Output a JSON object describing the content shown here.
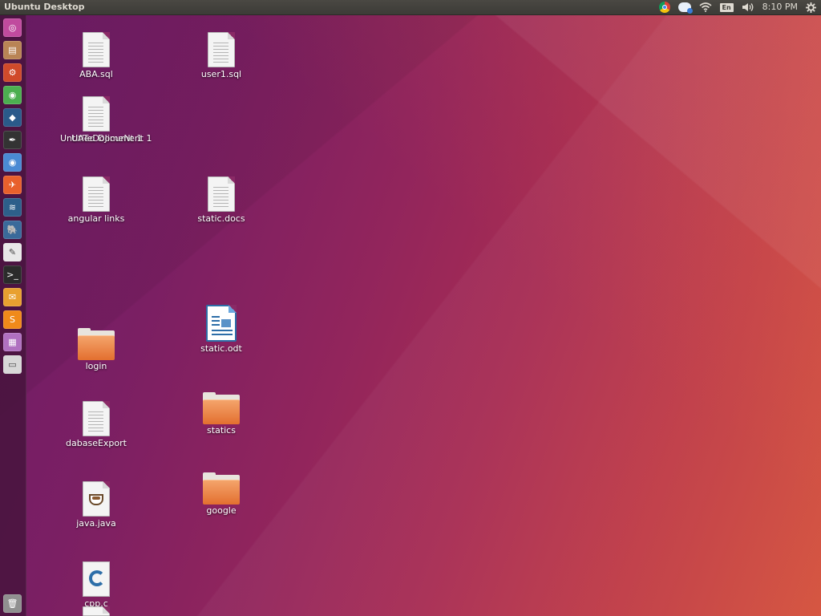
{
  "top_panel": {
    "title": "Ubuntu Desktop",
    "indicators": {
      "keyboard_layout": "En",
      "clock": "8:10 PM"
    }
  },
  "launcher": {
    "items": [
      {
        "icon": "ubuntu-dash-icon",
        "color": "#c04a9e"
      },
      {
        "icon": "file-manager-icon",
        "color": "#b98455"
      },
      {
        "icon": "system-settings-icon",
        "color": "#d04a2a"
      },
      {
        "icon": "chrome-icon",
        "color": "#4caf50"
      },
      {
        "icon": "mysql-workbench-icon",
        "color": "#2a5a8a"
      },
      {
        "icon": "inkscape-icon",
        "color": "#333333"
      },
      {
        "icon": "chromium-icon",
        "color": "#4a8ad4"
      },
      {
        "icon": "postman-icon",
        "color": "#e8602c"
      },
      {
        "icon": "mysql-icon",
        "color": "#2d5f8a"
      },
      {
        "icon": "postgresql-icon",
        "color": "#3a6a9a"
      },
      {
        "icon": "text-editor-icon",
        "color": "#e8e8e8"
      },
      {
        "icon": "terminal-icon",
        "color": "#2b2b2b"
      },
      {
        "icon": "mail-icon",
        "color": "#e8a030"
      },
      {
        "icon": "sublime-text-icon",
        "color": "#f08a1a"
      },
      {
        "icon": "software-center-icon",
        "color": "#b070c0"
      },
      {
        "icon": "disk-icon",
        "color": "#d8d8d8"
      },
      {
        "icon": "trash-icon",
        "color": "#909090"
      }
    ]
  },
  "desktop_icons": [
    {
      "name": "aba-sql",
      "type": "text",
      "label": "ABA.sql"
    },
    {
      "name": "user1-sql",
      "type": "text",
      "label": "user1.sql"
    },
    {
      "name": "untitled-document-1",
      "type": "text",
      "label": "Untitled Document 1",
      "overlap_label": "UATeDoJimeNt 1"
    },
    {
      "name": "angular-links",
      "type": "text",
      "label": "angular links"
    },
    {
      "name": "static-docs",
      "type": "text",
      "label": "static.docs"
    },
    {
      "name": "static-odt",
      "type": "odt",
      "label": "static.odt"
    },
    {
      "name": "login",
      "type": "folder",
      "label": "login"
    },
    {
      "name": "statics",
      "type": "folder",
      "label": "statics"
    },
    {
      "name": "dabaseexport",
      "type": "text",
      "label": "dabaseExport"
    },
    {
      "name": "google",
      "type": "folder",
      "label": "google"
    },
    {
      "name": "java-java",
      "type": "java",
      "label": "java.java"
    },
    {
      "name": "cpp-c",
      "type": "c",
      "label": "cpp.c"
    }
  ]
}
